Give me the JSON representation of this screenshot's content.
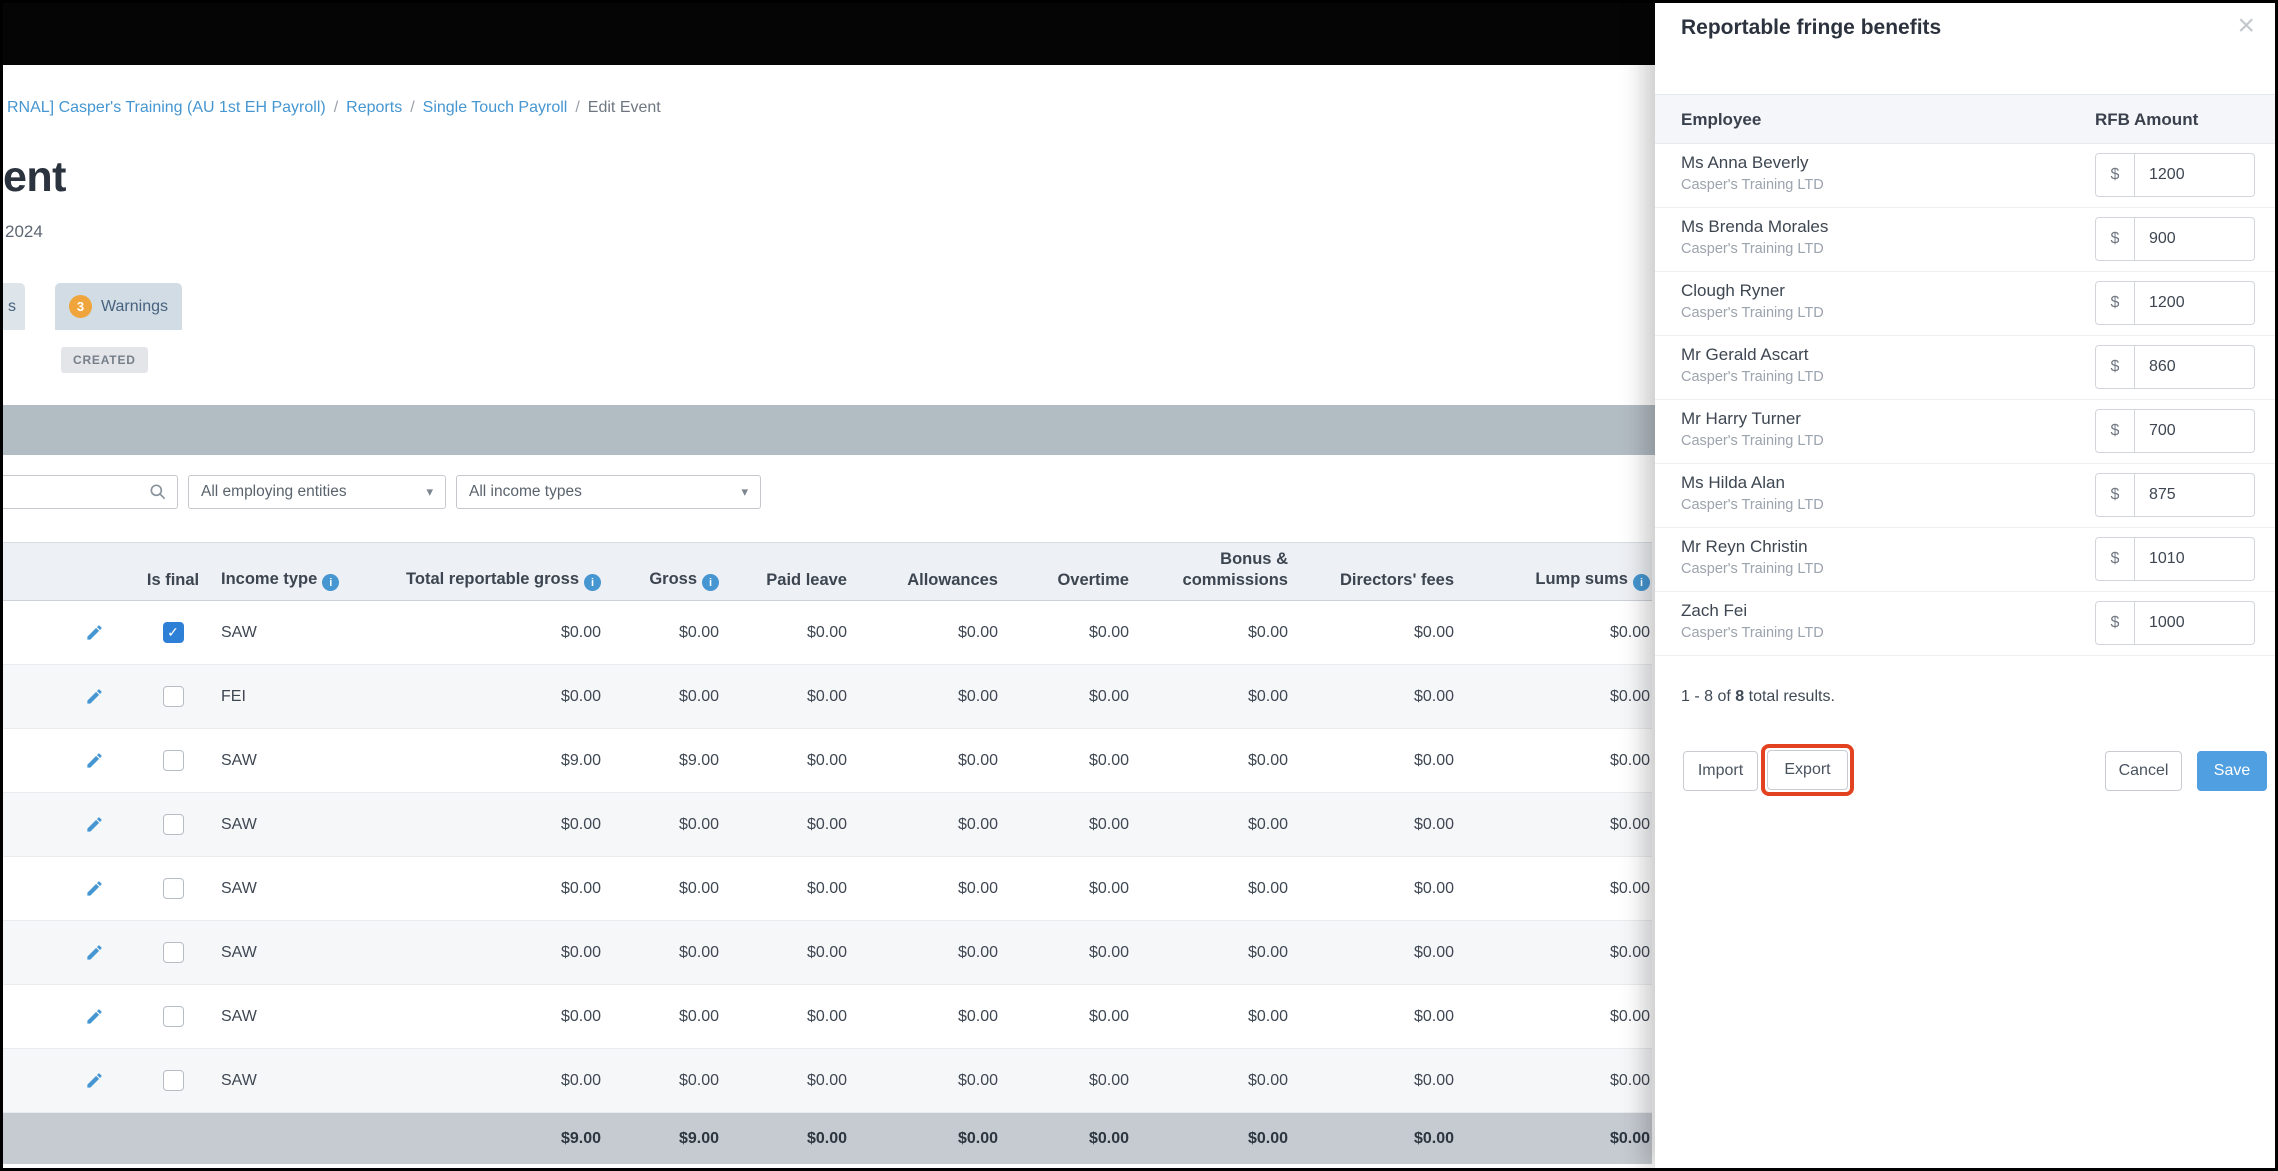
{
  "colors": {
    "link_blue": "#4596d1",
    "save_button_blue": "#4f9fe1",
    "export_highlight": "#e2421f",
    "warning_badge_orange": "#efa53b",
    "checkbox_checked_blue": "#2e7fd6"
  },
  "icons": {
    "search": "magnifier",
    "close": "×",
    "chevron_down": "▾",
    "info": "i",
    "check": "✓",
    "edit": "pencil"
  },
  "page": {
    "breadcrumb": [
      {
        "label": "RNAL] Casper's Training (AU 1st EH Payroll)",
        "type": "link"
      },
      {
        "label": "Reports",
        "type": "link"
      },
      {
        "label": "Single Touch Payroll",
        "type": "link"
      },
      {
        "label": "Edit Event",
        "type": "current"
      }
    ],
    "title_visible": "ent",
    "subtitle_visible": "2024",
    "tabs": [
      {
        "label_visible": "s",
        "partial": true
      },
      {
        "label": "Warnings",
        "badge_count": "3",
        "selected": true
      }
    ],
    "status_badge": "CREATED",
    "filters": {
      "employing_entities_value": "All employing entities",
      "income_types_value": "All income types"
    },
    "table": {
      "columns": [
        {
          "id": "edit",
          "label": "",
          "align": "c"
        },
        {
          "id": "is_final",
          "label": "Is final",
          "align": "c"
        },
        {
          "id": "income_type",
          "label": "Income type",
          "info": true,
          "align": "l"
        },
        {
          "id": "total_reportable_gross",
          "label": "Total reportable gross",
          "info": true,
          "align": "r"
        },
        {
          "id": "gross",
          "label": "Gross",
          "info": true,
          "align": "r"
        },
        {
          "id": "paid_leave",
          "label": "Paid leave",
          "align": "r"
        },
        {
          "id": "allowances",
          "label": "Allowances",
          "align": "r"
        },
        {
          "id": "overtime",
          "label": "Overtime",
          "align": "r"
        },
        {
          "id": "bonus_commissions",
          "label": "Bonus & commissions",
          "align": "r"
        },
        {
          "id": "directors_fees",
          "label": "Directors' fees",
          "align": "r"
        },
        {
          "id": "lump_sums",
          "label": "Lump sums",
          "info": true,
          "align": "r"
        }
      ],
      "rows": [
        {
          "is_final": true,
          "income_type": "SAW",
          "values": [
            "$0.00",
            "$0.00",
            "$0.00",
            "$0.00",
            "$0.00",
            "$0.00",
            "$0.00",
            "$0.00"
          ]
        },
        {
          "is_final": false,
          "income_type": "FEI",
          "values": [
            "$0.00",
            "$0.00",
            "$0.00",
            "$0.00",
            "$0.00",
            "$0.00",
            "$0.00",
            "$0.00"
          ]
        },
        {
          "is_final": false,
          "income_type": "SAW",
          "values": [
            "$9.00",
            "$9.00",
            "$0.00",
            "$0.00",
            "$0.00",
            "$0.00",
            "$0.00",
            "$0.00"
          ]
        },
        {
          "is_final": false,
          "income_type": "SAW",
          "values": [
            "$0.00",
            "$0.00",
            "$0.00",
            "$0.00",
            "$0.00",
            "$0.00",
            "$0.00",
            "$0.00"
          ]
        },
        {
          "is_final": false,
          "income_type": "SAW",
          "values": [
            "$0.00",
            "$0.00",
            "$0.00",
            "$0.00",
            "$0.00",
            "$0.00",
            "$0.00",
            "$0.00"
          ]
        },
        {
          "is_final": false,
          "income_type": "SAW",
          "values": [
            "$0.00",
            "$0.00",
            "$0.00",
            "$0.00",
            "$0.00",
            "$0.00",
            "$0.00",
            "$0.00"
          ]
        },
        {
          "is_final": false,
          "income_type": "SAW",
          "values": [
            "$0.00",
            "$0.00",
            "$0.00",
            "$0.00",
            "$0.00",
            "$0.00",
            "$0.00",
            "$0.00"
          ]
        },
        {
          "is_final": false,
          "income_type": "SAW",
          "values": [
            "$0.00",
            "$0.00",
            "$0.00",
            "$0.00",
            "$0.00",
            "$0.00",
            "$0.00",
            "$0.00"
          ]
        }
      ],
      "totals": [
        "$9.00",
        "$9.00",
        "$0.00",
        "$0.00",
        "$0.00",
        "$0.00",
        "$0.00",
        "$0.00"
      ]
    }
  },
  "panel": {
    "title": "Reportable fringe benefits",
    "table": {
      "employee_header": "Employee",
      "amount_header": "RFB Amount"
    },
    "currency": "$",
    "employees": [
      {
        "name": "Ms Anna Beverly",
        "company": "Casper's Training LTD",
        "amount": "1200"
      },
      {
        "name": "Ms Brenda Morales",
        "company": "Casper's Training LTD",
        "amount": "900"
      },
      {
        "name": "Clough Ryner",
        "company": "Casper's Training LTD",
        "amount": "1200"
      },
      {
        "name": "Mr Gerald Ascart",
        "company": "Casper's Training LTD",
        "amount": "860"
      },
      {
        "name": "Mr Harry Turner",
        "company": "Casper's Training LTD",
        "amount": "700"
      },
      {
        "name": "Ms Hilda Alan",
        "company": "Casper's Training LTD",
        "amount": "875"
      },
      {
        "name": "Mr Reyn Christin",
        "company": "Casper's Training LTD",
        "amount": "1010"
      },
      {
        "name": "Zach Fei",
        "company": "Casper's Training LTD",
        "amount": "1000"
      }
    ],
    "results": {
      "range": "1 - 8 of",
      "total": "8",
      "suffix": "total results."
    },
    "buttons": {
      "import": "Import",
      "export": "Export",
      "cancel": "Cancel",
      "save": "Save"
    }
  }
}
